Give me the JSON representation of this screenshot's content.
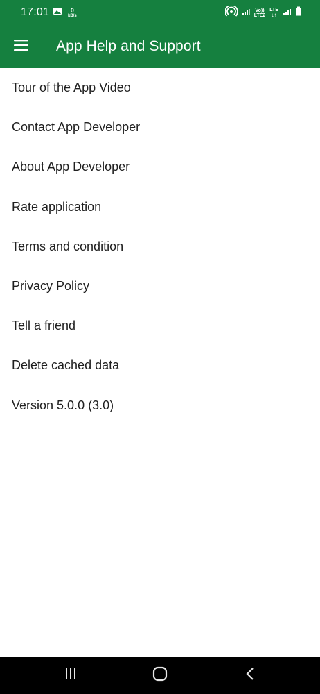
{
  "status_bar": {
    "time": "17:01",
    "data_rate_value": "0",
    "data_rate_unit": "kB/s",
    "volte_label": "Vo))",
    "lte2_label": "LTE2",
    "lte_label": "LTE",
    "icons": [
      "image-icon",
      "hotspot-icon",
      "signal-icon",
      "signal-icon",
      "battery-icon"
    ]
  },
  "app_bar": {
    "title": "App Help and Support",
    "menu_icon": "hamburger-menu-icon",
    "color": "#15803f"
  },
  "menu": {
    "items": [
      {
        "label": "Tour of the App Video"
      },
      {
        "label": "Contact App Developer"
      },
      {
        "label": "About App Developer"
      },
      {
        "label": "Rate application"
      },
      {
        "label": "Terms and condition"
      },
      {
        "label": "Privacy Policy"
      },
      {
        "label": "Tell a friend"
      },
      {
        "label": "Delete cached data"
      },
      {
        "label": "Version 5.0.0 (3.0)"
      }
    ]
  },
  "nav_bar": {
    "icons": [
      "recent-apps-icon",
      "home-icon",
      "back-icon"
    ]
  }
}
